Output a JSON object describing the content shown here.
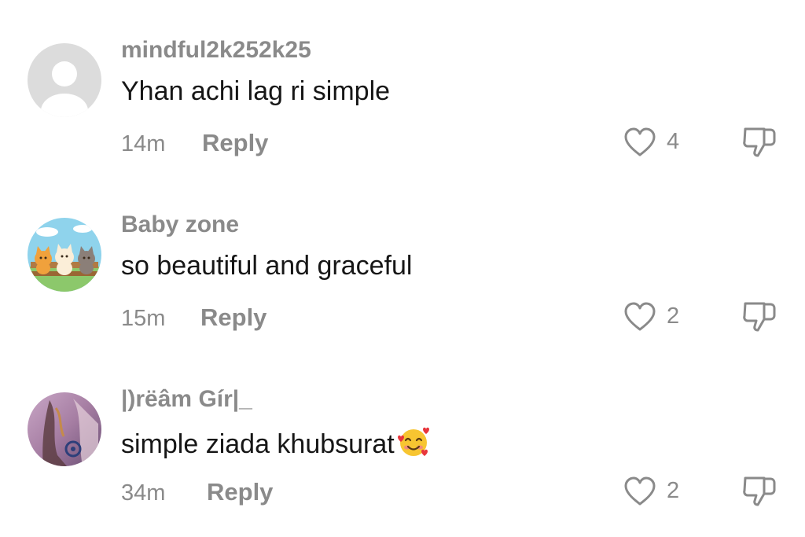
{
  "comments": [
    {
      "username": "mindful2k252k25",
      "text": "Yhan achi lag ri simple",
      "time": "14m",
      "reply_label": "Reply",
      "likes": "4",
      "avatar": "default-avatar"
    },
    {
      "username": "Baby zone",
      "text": "so beautiful and graceful",
      "time": "15m",
      "reply_label": "Reply",
      "likes": "2",
      "avatar": "cartoon-cats-avatar"
    },
    {
      "username": "|)rëâm Gír|_",
      "text": "simple ziada khubsurat",
      "emoji": "smiling-face-with-hearts-emoji",
      "time": "34m",
      "reply_label": "Reply",
      "likes": "2",
      "avatar": "photo-avatar"
    }
  ],
  "colors": {
    "secondary_text": "#8a8a8a",
    "primary_text": "#161616",
    "icon": "#8a8a8a",
    "background": "#ffffff"
  }
}
